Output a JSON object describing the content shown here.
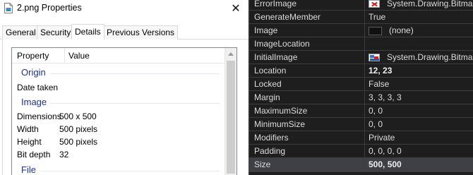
{
  "dialog": {
    "title": "2.png Properties",
    "tabs": [
      {
        "label": "General",
        "active": false
      },
      {
        "label": "Security",
        "active": false
      },
      {
        "label": "Details",
        "active": true
      },
      {
        "label": "Previous Versions",
        "active": false
      }
    ],
    "columns": {
      "property": "Property",
      "value": "Value"
    },
    "groups": {
      "origin": "Origin",
      "image": "Image",
      "file": "File"
    },
    "rows": {
      "date_taken": {
        "key": "Date taken",
        "value": ""
      },
      "dimensions": {
        "key": "Dimensions",
        "value": "500 x 500"
      },
      "width": {
        "key": "Width",
        "value": "500 pixels"
      },
      "height": {
        "key": "Height",
        "value": "500 pixels"
      },
      "bit_depth": {
        "key": "Bit depth",
        "value": "32"
      }
    }
  },
  "property_grid": {
    "rows": [
      {
        "name": "ErrorImage",
        "value": "System.Drawing.Bitmap",
        "swatch": "error-image",
        "bold": false
      },
      {
        "name": "GenerateMember",
        "value": "True",
        "swatch": "",
        "bold": false
      },
      {
        "name": "Image",
        "value": "(none)",
        "swatch": "empty",
        "bold": false
      },
      {
        "name": "ImageLocation",
        "value": "",
        "swatch": "",
        "bold": false
      },
      {
        "name": "InitialImage",
        "value": "System.Drawing.Bitmap",
        "swatch": "picture",
        "bold": false
      },
      {
        "name": "Location",
        "value": "12, 23",
        "swatch": "",
        "bold": true
      },
      {
        "name": "Locked",
        "value": "False",
        "swatch": "",
        "bold": false
      },
      {
        "name": "Margin",
        "value": "3, 3, 3, 3",
        "swatch": "",
        "bold": false
      },
      {
        "name": "MaximumSize",
        "value": "0, 0",
        "swatch": "",
        "bold": false
      },
      {
        "name": "MinimumSize",
        "value": "0, 0",
        "swatch": "",
        "bold": false
      },
      {
        "name": "Modifiers",
        "value": "Private",
        "swatch": "",
        "bold": false
      },
      {
        "name": "Padding",
        "value": "0, 0, 0, 0",
        "swatch": "",
        "bold": false
      },
      {
        "name": "Size",
        "value": "500, 500",
        "swatch": "",
        "bold": true,
        "selected": true
      }
    ]
  },
  "colors": {
    "group_heading": "#1e3287",
    "grid_background": "#1e1e1e",
    "grid_text": "#dcdcdc",
    "grid_selected": "#3f3f46"
  }
}
